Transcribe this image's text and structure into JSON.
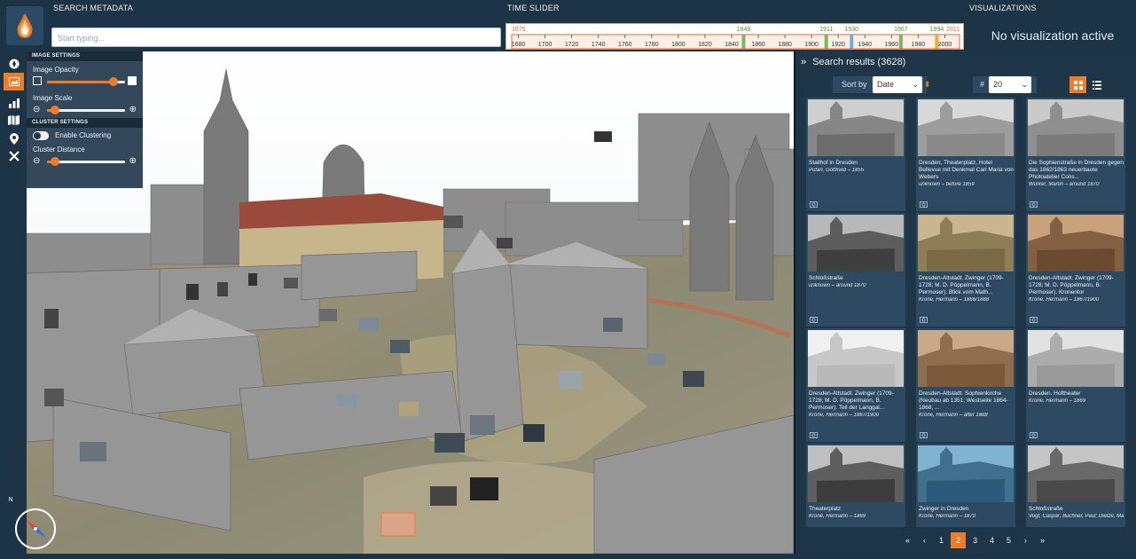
{
  "header": {
    "search_label": "SEARCH METADATA",
    "search_placeholder": "Start typing...",
    "timeslider_label": "TIME SLIDER",
    "visualizations_label": "VISUALIZATIONS",
    "visualizations_status": "No visualization active"
  },
  "timeslider": {
    "range_start": "1675",
    "range_end": "2011",
    "markers": [
      "1849",
      "1911",
      "1930",
      "1967",
      "1994"
    ],
    "ticks": [
      "1680",
      "1700",
      "1720",
      "1740",
      "1760",
      "1780",
      "1800",
      "1820",
      "1840",
      "1860",
      "1880",
      "1900",
      "1920",
      "1940",
      "1960",
      "1980",
      "2000"
    ],
    "accent_color": "#e06a3b"
  },
  "settings": {
    "image_settings_header": "IMAGE SETTINGS",
    "image_opacity_label": "Image Opacity",
    "image_opacity_value": 0.85,
    "image_scale_label": "Image Scale",
    "image_scale_value": 0.1,
    "cluster_settings_header": "CLUSTER SETTINGS",
    "enable_clustering_label": "Enable Clustering",
    "enable_clustering": false,
    "cluster_distance_label": "Cluster Distance",
    "cluster_distance_value": 0.1
  },
  "toolbar": {
    "icons": [
      "compass-icon",
      "image-icon",
      "chart-icon",
      "map-icon",
      "location-pin-icon",
      "tools-icon"
    ],
    "active_index": 1
  },
  "compass": {
    "north_label": "N"
  },
  "results": {
    "title": "Search results (3628)",
    "sort_label": "Sort by",
    "sort_value": "Date",
    "count_label": "#",
    "count_value": "20",
    "cards": [
      {
        "title": "Stallhof in Dresden",
        "author": "Pufan, Gottfried – 1855"
      },
      {
        "title": "Dresden, Theaterplatz, Hotel Bellevue mit Denkmal Carl Maria von Webers",
        "author": "unknown – before 1859"
      },
      {
        "title": "Die Sophienstraße in Dresden gegen das 1862/1863 neuerbaute Photoatelier Cons...",
        "author": "Würker, Martin – around 1870"
      },
      {
        "title": "Schloßstraße",
        "author": "unknown – around 1870"
      },
      {
        "title": "Dresden-Altstadt. Zwinger (1709-1728; M. D. Pöppelmann, B. Permoser). Blick vom Math...",
        "author": "Krone, Hermann – 1866/1888"
      },
      {
        "title": "Dresden-Altstadt. Zwinger (1709-1728; M. D. Pöppelmann, B. Permoser). Kronentor",
        "author": "Krone, Hermann – 1867/1900"
      },
      {
        "title": "Dresden-Altstadt. Zwinger (1709-1728; M. D. Pöppelmann, B. Permoser). Teil der Langgal...",
        "author": "Krone, Hermann – 1867/1900"
      },
      {
        "title": "Dresden-Altstadt. Sophienkirche (Neubau ab 1351; Westseite 1864-1868, ...",
        "author": "Krone, Hermann – after 1888"
      },
      {
        "title": "Dresden. Hoftheater",
        "author": "Krone, Hermann – 1869"
      },
      {
        "title": "Theaterplatz",
        "author": "Krone, Hermann – 1869"
      },
      {
        "title": "Zwinger in Dresden",
        "author": "Krone, Hermann – 1870"
      },
      {
        "title": "Schloßstraße",
        "author": "Vogt, Caspar; Buchner, Paul; Dietze, Marcus Conrad; Klengel,"
      }
    ],
    "pagination": {
      "first": "«",
      "prev": "‹",
      "pages": [
        "1",
        "2",
        "3",
        "4",
        "5"
      ],
      "current": "2",
      "next": "›",
      "last": "»"
    }
  },
  "colors": {
    "accent": "#ee7d2b",
    "panel": "#1f3548",
    "header": "#1d3346",
    "card": "#2e4a63"
  }
}
